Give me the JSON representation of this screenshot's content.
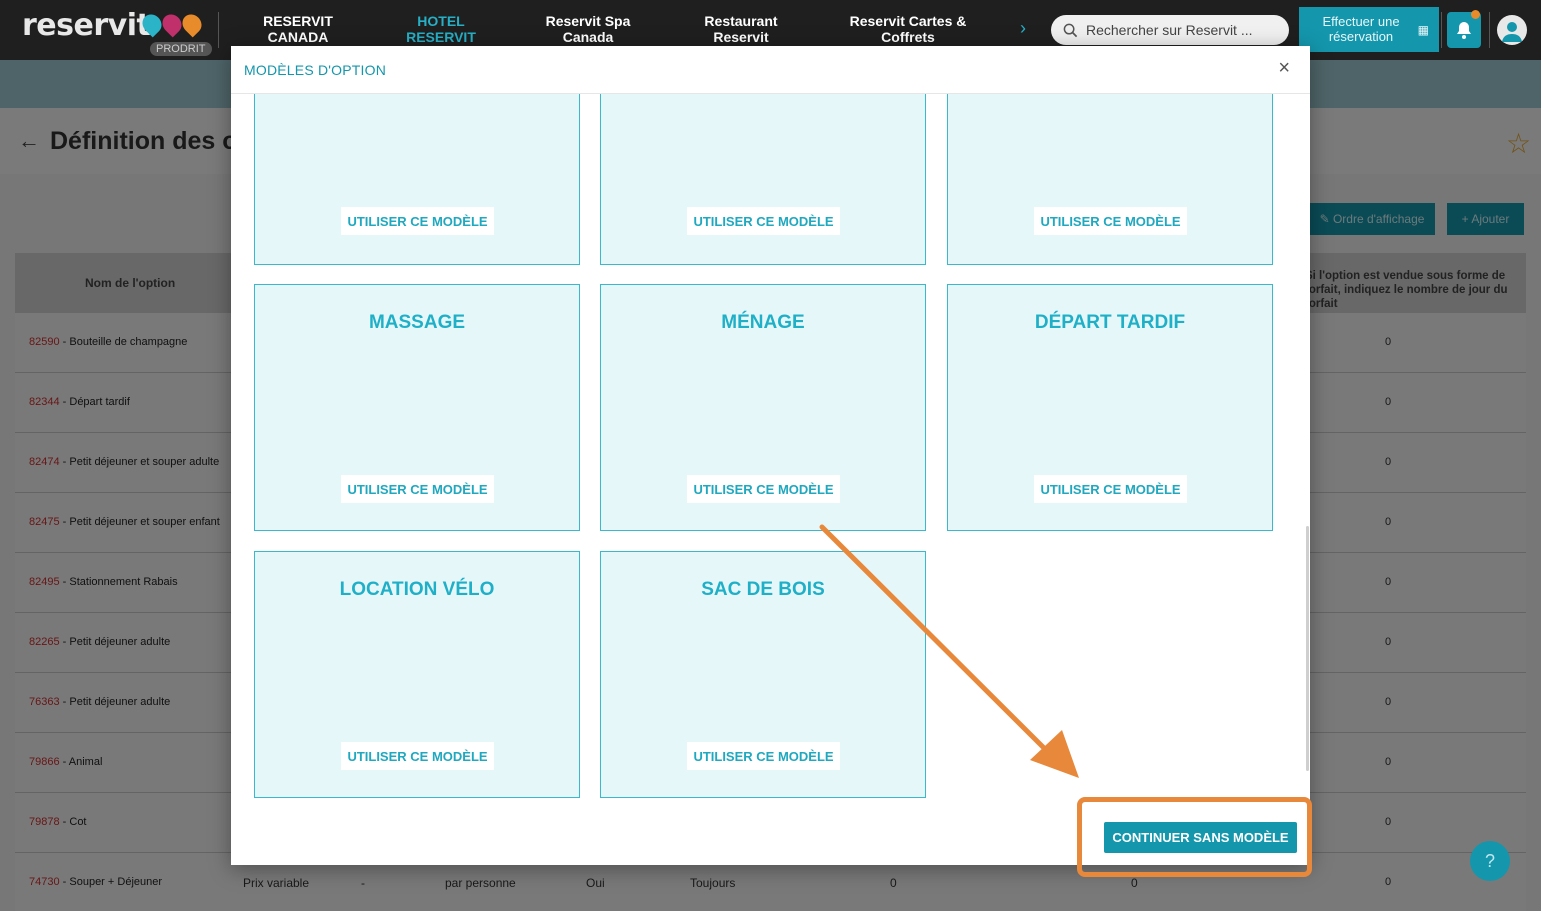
{
  "brand": {
    "logo": "reservit",
    "badge": "PRODRIT"
  },
  "nav": {
    "items": [
      {
        "label": "RESERVIT CANADA"
      },
      {
        "label": "HOTEL RESERVIT"
      },
      {
        "label": "Reservit Spa Canada"
      },
      {
        "label": "Restaurant Reservit"
      },
      {
        "label": "Reservit Cartes & Coffrets"
      }
    ],
    "active": "HOTEL RESERVIT"
  },
  "search": {
    "placeholder": "Rechercher sur Reservit ..."
  },
  "booking_button": {
    "label": "Effectuer une réservation"
  },
  "page": {
    "title": "Définition des options",
    "order_button": "✎ Ordre d'affichage",
    "add_button": "+ Ajouter",
    "table": {
      "col_name": "Nom de l'option",
      "col_forfait": "Si l'option est vendue sous forme de forfait, indiquez le nombre de jour du forfait",
      "rows": [
        {
          "id": "82590",
          "name": "Bouteille de champagne",
          "forfait": "0"
        },
        {
          "id": "82344",
          "name": "Départ tardif",
          "forfait": "0"
        },
        {
          "id": "82474",
          "name": "Petit déjeuner et souper adulte",
          "forfait": "0"
        },
        {
          "id": "82475",
          "name": "Petit déjeuner et souper enfant",
          "forfait": "0"
        },
        {
          "id": "82495",
          "name": "Stationnement Rabais",
          "forfait": "0"
        },
        {
          "id": "82265",
          "name": "Petit déjeuner adulte",
          "forfait": "0"
        },
        {
          "id": "76363",
          "name": "Petit déjeuner adulte",
          "forfait": "0"
        },
        {
          "id": "79866",
          "name": "Animal",
          "forfait": "0"
        },
        {
          "id": "79878",
          "name": "Cot",
          "forfait": "0"
        },
        {
          "id": "74730",
          "name": "Souper + Déjeuner",
          "forfait": "0",
          "price": "Prix variable",
          "dash": "-",
          "unit": "par personne",
          "yes": "Oui",
          "when": "Toujours",
          "zero_a": "0",
          "zero_b": "0"
        }
      ]
    }
  },
  "modal": {
    "title": "MODÈLES D'OPTION",
    "close_glyph": "×",
    "use_template_label": "UTILISER CE MODÈLE",
    "templates_row1": [
      "",
      "",
      ""
    ],
    "templates_row2": [
      "MASSAGE",
      "MÉNAGE",
      "DÉPART TARDIF"
    ],
    "templates_row3": [
      "LOCATION VÉLO",
      "SAC DE BOIS"
    ],
    "continue_label": "CONTINUER SANS MODÈLE"
  },
  "help": {
    "label": "?"
  },
  "colors": {
    "accent": "#1496ac",
    "card_bg": "#e6f7fa",
    "card_title": "#1fb0c8",
    "annotation": "#e8883a"
  }
}
